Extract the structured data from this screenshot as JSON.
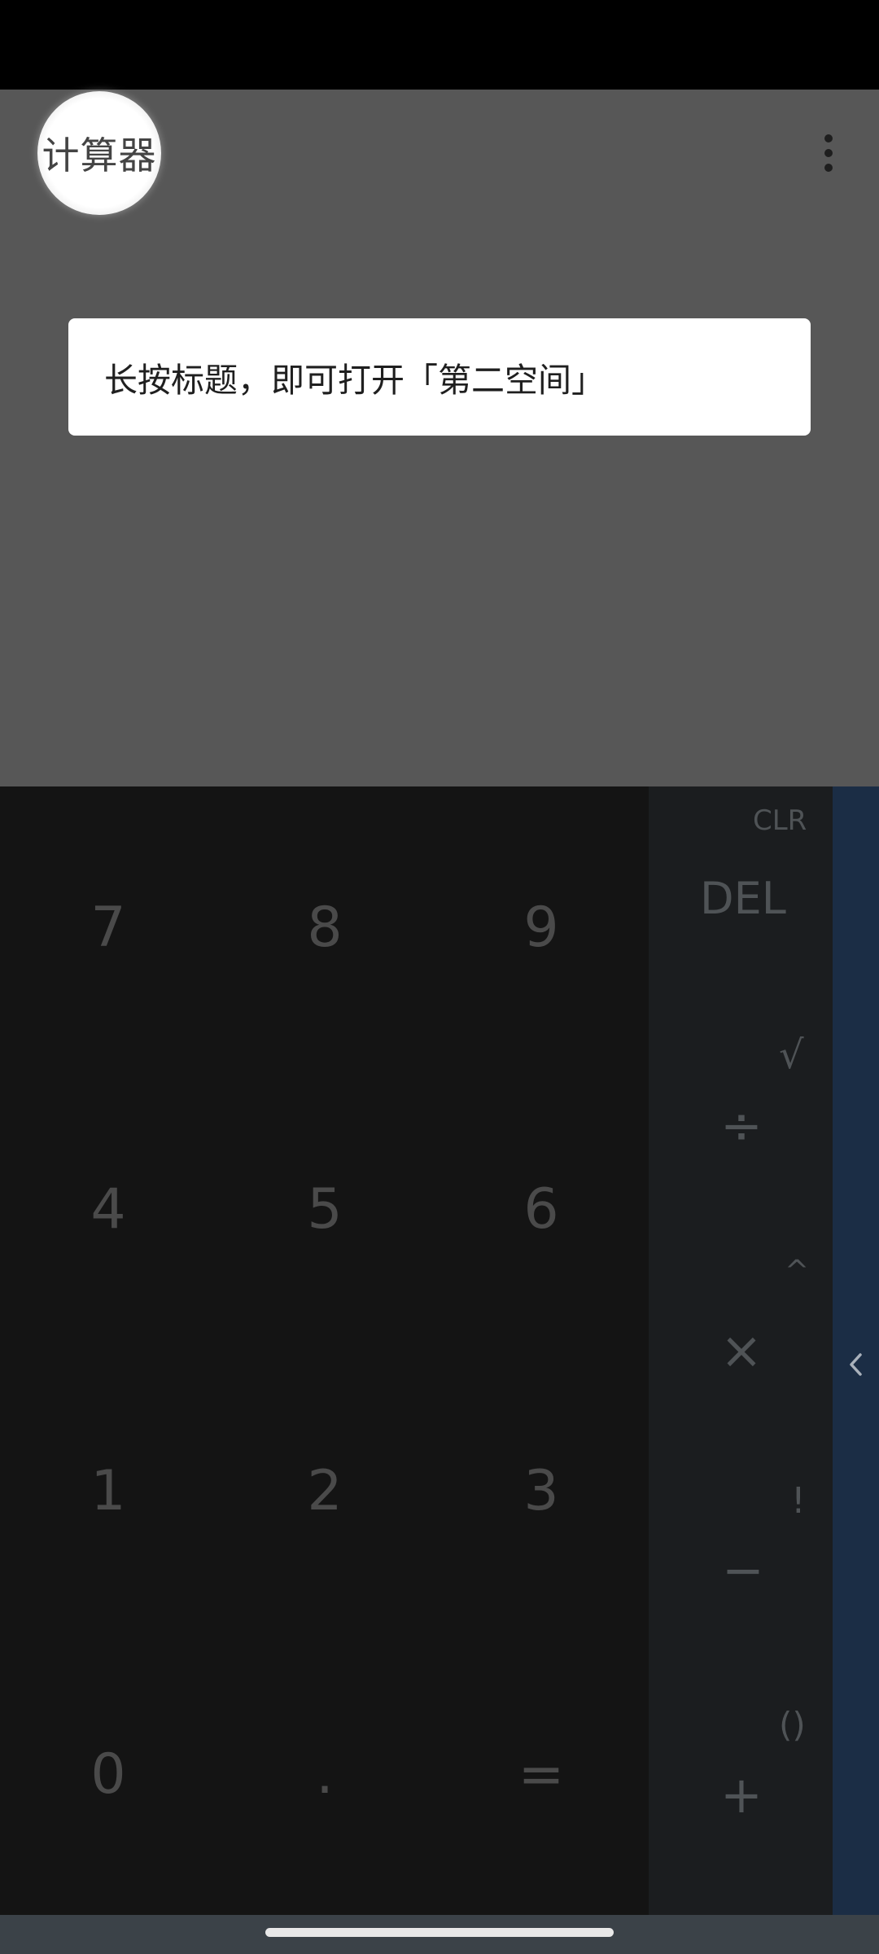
{
  "app": {
    "title": "计算器"
  },
  "tooltip": {
    "text": "长按标题，即可打开「第二空间」"
  },
  "keypad": {
    "keys": [
      "7",
      "8",
      "9",
      "4",
      "5",
      "6",
      "1",
      "2",
      "3",
      "0",
      ".",
      "="
    ]
  },
  "operators": {
    "clr": "CLR",
    "del": "DEL",
    "sqrt": "√",
    "divide": "÷",
    "power": "^",
    "multiply": "×",
    "factorial": "!",
    "minus": "−",
    "parens": "()",
    "plus": "+"
  },
  "icons": {
    "more": "more-vertical-icon",
    "advanced": "chevron-left-icon"
  },
  "colors": {
    "display_bg": "#575757",
    "keypad_bg": "#141414",
    "ops_bg": "#1b1d1f",
    "advanced_panel": "#1b2d45"
  }
}
